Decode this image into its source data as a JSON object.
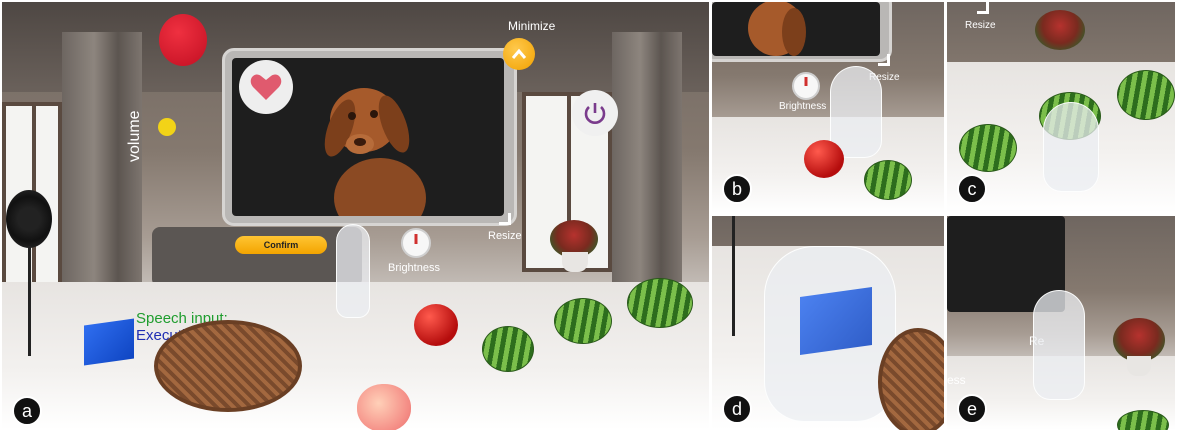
{
  "panels": {
    "a": {
      "badge": "a",
      "volume_label": "volume",
      "minimize_label": "Minimize",
      "resize_label": "Resize",
      "brightness_label": "Brightness",
      "confirm_label": "Confirm",
      "speech_input_label": "Speech input:",
      "executing_label": "Executing:",
      "colors": {
        "speech": "#1f9d2e",
        "executing": "#1f2db3",
        "confirm": "#f3a400",
        "minimize": "#f1a100",
        "heart": "#e05a6e",
        "power": "#7a3b8c"
      },
      "icons": [
        "heart-icon",
        "power-icon",
        "chevron-up-icon"
      ]
    },
    "b": {
      "badge": "b",
      "brightness_label": "Brightness",
      "resize_label": "Resize"
    },
    "c": {
      "badge": "c",
      "resize_label": "Resize"
    },
    "d": {
      "badge": "d"
    },
    "e": {
      "badge": "e",
      "resize_label_partial": "Re",
      "brightness_label_partial": "ess"
    }
  }
}
